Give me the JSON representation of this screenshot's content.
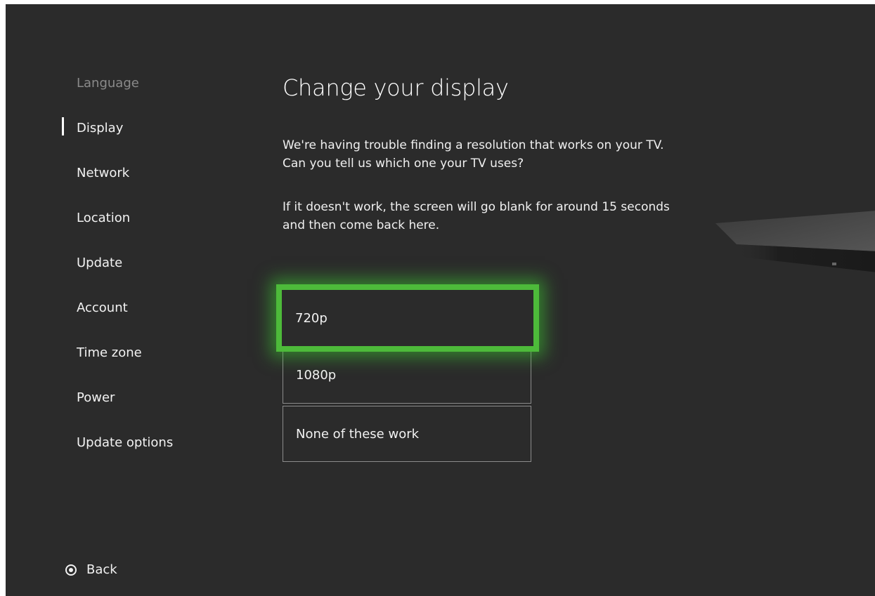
{
  "nav": {
    "items": [
      {
        "label": "Language",
        "state": "dimmed"
      },
      {
        "label": "Display",
        "state": "current"
      },
      {
        "label": "Network",
        "state": "normal"
      },
      {
        "label": "Location",
        "state": "normal"
      },
      {
        "label": "Update",
        "state": "normal"
      },
      {
        "label": "Account",
        "state": "normal"
      },
      {
        "label": "Time zone",
        "state": "normal"
      },
      {
        "label": "Power",
        "state": "normal"
      },
      {
        "label": "Update options",
        "state": "normal"
      }
    ],
    "back_label": "Back"
  },
  "main": {
    "title": "Change your display",
    "paragraph1": {
      "line1": "We're having trouble finding a resolution that works on your TV.",
      "line2": "Can you tell us which one your TV uses?"
    },
    "paragraph2": {
      "line1": "If it doesn't work, the screen will go blank for around 15 seconds",
      "line2": "and then come back here."
    },
    "options": [
      {
        "label": "720p",
        "focused": true
      },
      {
        "label": "1080p",
        "focused": false
      },
      {
        "label": "None of these work",
        "focused": false
      }
    ]
  },
  "colors": {
    "background": "#2b2b2b",
    "focus_accent": "#4dba3a",
    "text": "#f2f2f2",
    "dim_text": "#8a8a8a"
  },
  "icons": {
    "back": "back-button-icon",
    "console": "console-graphic"
  }
}
